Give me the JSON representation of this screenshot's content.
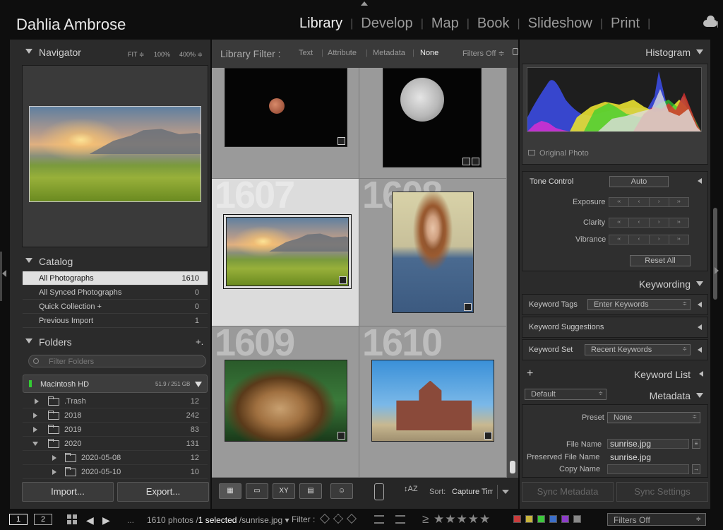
{
  "app": {
    "identity_plate": "Dahlia Ambrose",
    "modules": [
      "Library",
      "Develop",
      "Map",
      "Book",
      "Slideshow",
      "Print"
    ],
    "active_module": "Library",
    "separator": "|"
  },
  "left_panel": {
    "navigator": {
      "title": "Navigator",
      "zoom_options": [
        "FIT ≑",
        "100%",
        "400% ≑"
      ]
    },
    "catalog": {
      "title": "Catalog",
      "items": [
        {
          "label": "All Photographs",
          "count": "1610",
          "selected": true
        },
        {
          "label": "All Synced Photographs",
          "count": "0"
        },
        {
          "label": "Quick Collection +",
          "count": "0"
        },
        {
          "label": "Previous Import",
          "count": "1"
        }
      ]
    },
    "folders": {
      "title": "Folders",
      "add_symbol": "+.",
      "filter_placeholder": "Filter Folders",
      "volume": {
        "name": "Macintosh HD",
        "size": "51.9 / 251 GB"
      },
      "rows": [
        {
          "label": ".Trash",
          "count": "12"
        },
        {
          "label": "2018",
          "count": "242"
        },
        {
          "label": "2019",
          "count": "83"
        },
        {
          "label": "2020",
          "count": "131"
        },
        {
          "label": "2020-05-08",
          "count": "12"
        },
        {
          "label": "2020-05-10",
          "count": "10"
        }
      ]
    },
    "import_label": "Import...",
    "export_label": "Export..."
  },
  "center": {
    "filter_bar": {
      "title": "Library Filter :",
      "items": [
        "Text",
        "Attribute",
        "Metadata",
        "None"
      ],
      "active": "None",
      "filters_off": "Filters Off ≑"
    },
    "cells": [
      {
        "index": "",
        "kind": "moon-small"
      },
      {
        "index": "",
        "kind": "moon-big"
      },
      {
        "index": "1607",
        "kind": "sunrise",
        "selected": true
      },
      {
        "index": "1608",
        "kind": "portrait"
      },
      {
        "index": "1609",
        "kind": "lion"
      },
      {
        "index": "1610",
        "kind": "church"
      }
    ],
    "toolbar": {
      "sort_label": "Sort:",
      "sort_value": "Capture Time",
      "loupe_glyph": "XY"
    }
  },
  "right_panel": {
    "histogram": {
      "title": "Histogram",
      "original_photo": "Original Photo"
    },
    "quick_develop": {
      "tone_control": "Tone Control",
      "auto": "Auto",
      "exposure": "Exposure",
      "clarity": "Clarity",
      "vibrance": "Vibrance",
      "reset_all": "Reset All",
      "stepper_glyphs": [
        "‹‹",
        "‹",
        "›",
        "››"
      ]
    },
    "keywording": {
      "title": "Keywording",
      "keyword_tags_label": "Keyword Tags",
      "keyword_tags_value": "Enter Keywords",
      "keyword_suggestions": "Keyword Suggestions",
      "keyword_set_label": "Keyword Set",
      "keyword_set_value": "Recent Keywords"
    },
    "keyword_list": {
      "title": "Keyword List",
      "add": "+"
    },
    "metadata": {
      "title": "Metadata",
      "preset_dropdown": "Default",
      "preset_label": "Preset",
      "preset_value": "None",
      "file_name_label": "File Name",
      "file_name_value": "sunrise.jpg",
      "preserved_label": "Preserved File Name",
      "preserved_value": "sunrise.jpg",
      "copy_name_label": "Copy Name"
    },
    "sync_metadata": "Sync Metadata",
    "sync_settings": "Sync Settings"
  },
  "filmstrip": {
    "screen1": "1",
    "screen2": "2",
    "ellipsis": "...",
    "photo_count": "1610 photos /",
    "selected": "1 selected",
    "file": "/sunrise.jpg ▾",
    "filter_label": "Filter :",
    "stars": "≥ ★★★★★",
    "filters_off": "Filters Off",
    "color_labels": [
      "#c83c3c",
      "#c8b43c",
      "#3cc83c",
      "#3c6ec8",
      "#8c3cc8",
      "#888888"
    ]
  }
}
